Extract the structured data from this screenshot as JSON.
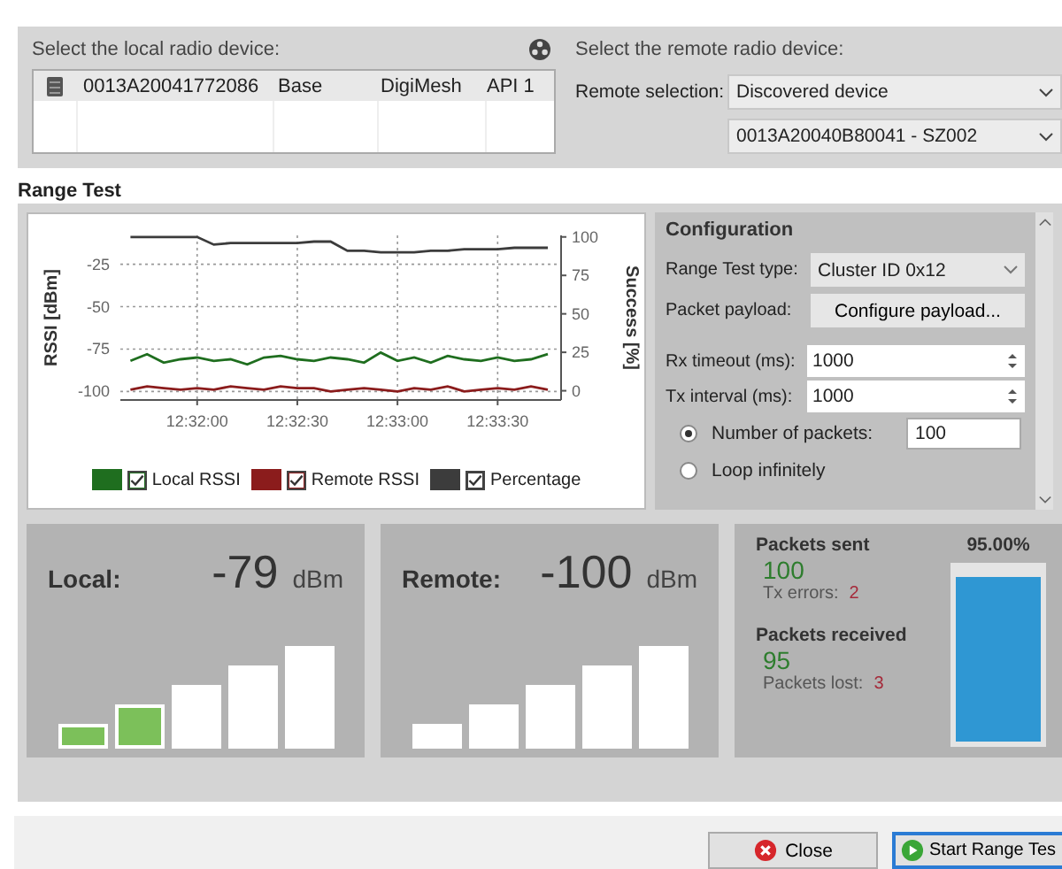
{
  "local_device": {
    "title": "Select the local radio device:",
    "rows": [
      {
        "mac": "0013A20041772086",
        "role": "Base",
        "protocol": "DigiMesh",
        "mode": "API 1",
        "selected": true
      }
    ]
  },
  "remote_device": {
    "title": "Select the remote radio device:",
    "selection_label": "Remote selection:",
    "selection": "Discovered device",
    "device": "0013A20040B80041 - SZ002"
  },
  "range_test": {
    "title": "Range Test",
    "chart": {
      "chart_data": {
        "type": "line",
        "ylabel": "RSSI [dBm]",
        "y2label": "Success [%]",
        "categories": [
          null,
          null,
          null,
          null,
          "12:32:00",
          null,
          null,
          null,
          null,
          null,
          "12:32:30",
          null,
          null,
          null,
          null,
          null,
          "12:33:00",
          null,
          null,
          null,
          null,
          null,
          "12:33:30",
          null,
          null,
          null
        ],
        "ylim": [
          -105,
          -8
        ],
        "y2lim": [
          -6,
          101
        ],
        "grid": true,
        "legend": true,
        "yticks": [
          -25,
          -50,
          -75,
          -100
        ],
        "y2ticks": [
          0,
          25,
          50,
          75,
          100
        ],
        "series": [
          {
            "name": "Local RSSI",
            "color": "#1f6e1f",
            "values": [
              -82,
              -78,
              -83,
              -81,
              -80,
              -82,
              -81,
              -84,
              -80,
              -79,
              -81,
              -82,
              -80,
              -81,
              -83,
              -77,
              -82,
              -80,
              -83,
              -79,
              -81,
              -82,
              -80,
              -82,
              -81,
              -78
            ]
          },
          {
            "name": "Remote RSSI",
            "color": "#8b1c1c",
            "values": [
              -99,
              -97,
              -98,
              -99,
              -98,
              -99,
              -97,
              -98,
              -99,
              -97,
              -98,
              -98,
              -100,
              -99,
              -98,
              -99,
              -100,
              -98,
              -99,
              -97,
              -100,
              -99,
              -98,
              -99,
              -97,
              -99
            ]
          },
          {
            "name": "Percentage",
            "color": "#3c3c3c",
            "axis": "y2",
            "values": [
              100,
              100,
              100,
              100,
              100,
              95,
              96,
              96,
              96,
              96,
              96,
              97,
              97,
              91,
              91,
              90,
              90,
              90,
              91,
              91,
              92,
              92,
              92,
              93,
              93,
              93
            ]
          }
        ]
      },
      "legend_checkboxes": [
        {
          "checked": true
        },
        {
          "checked": true
        },
        {
          "checked": true
        }
      ]
    },
    "configuration": {
      "title": "Configuration",
      "fields": [
        {
          "kind": "select",
          "label": "Range Test type:",
          "value": "Cluster ID 0x12"
        },
        {
          "kind": "button",
          "label": "Packet payload:",
          "value": "Configure payload..."
        },
        {
          "kind": "spin",
          "label": "Rx timeout (ms):",
          "value": "1000"
        },
        {
          "kind": "spin",
          "label": "Tx interval (ms):",
          "value": "1000"
        }
      ],
      "modes": [
        {
          "label": "Number of packets:",
          "selected": true,
          "value": "100"
        },
        {
          "label": "Loop infinitely",
          "selected": false
        }
      ]
    },
    "signals": [
      {
        "label": "Local:",
        "value": "-79",
        "unit": "dBm",
        "bars": [
          {
            "on": true
          },
          {
            "on": true
          },
          {
            "on": false
          },
          {
            "on": false
          },
          {
            "on": false
          }
        ]
      },
      {
        "label": "Remote:",
        "value": "-100",
        "unit": "dBm",
        "bars": [
          {
            "on": false
          },
          {
            "on": false
          },
          {
            "on": false
          },
          {
            "on": false
          },
          {
            "on": false
          }
        ]
      }
    ],
    "packets": {
      "sent_label": "Packets sent",
      "sent": "100",
      "errors_label": "Tx errors:",
      "errors": "2",
      "received_label": "Packets received",
      "received": "95",
      "lost_label": "Packets lost:",
      "lost": "3",
      "percent": "95.00%",
      "level": 0.95
    }
  },
  "buttons": [
    {
      "label": "Close",
      "kind": "close",
      "focused": false
    },
    {
      "label": "Start Range Tes",
      "kind": "start",
      "focused": true
    }
  ]
}
